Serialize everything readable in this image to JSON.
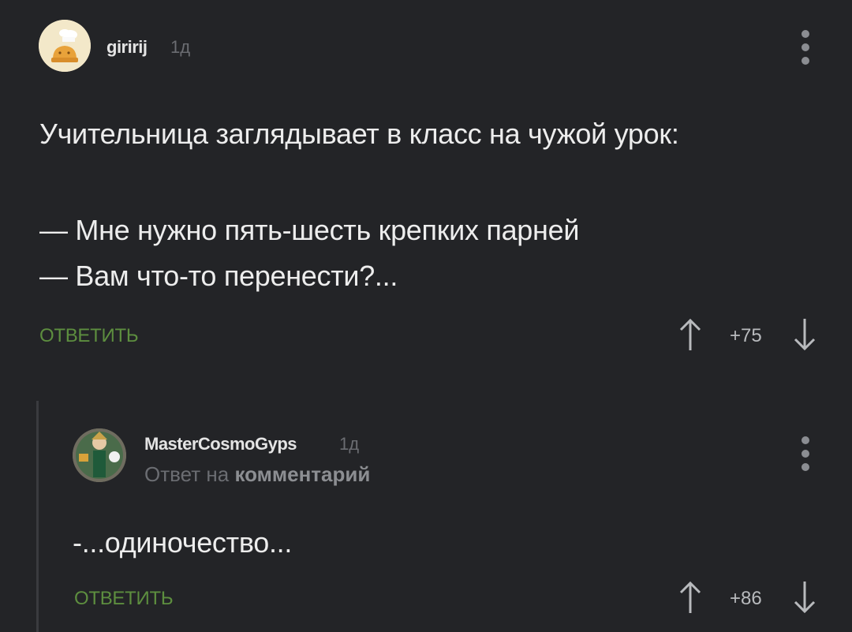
{
  "comment1": {
    "username": "giririj",
    "time": "1д",
    "text_line1": "Учительница заглядывает в класс на чужой урок:",
    "text_line2": "— Мне нужно пять-шесть крепких парней",
    "text_line3": "— Вам что-то перенести?...",
    "reply_label": "ОТВЕТИТЬ",
    "score": "+75",
    "avatar_icon": "chef-avatar-icon",
    "menu_icon": "more-vertical-icon"
  },
  "comment2": {
    "username": "MasterCosmoGyps",
    "time": "1д",
    "reply_prefix": "Ответ на",
    "reply_target": "комментарий",
    "text": "-...одиночество...",
    "reply_label": "ОТВЕТИТЬ",
    "score": "+86",
    "avatar_icon": "character-avatar-icon",
    "menu_icon": "more-vertical-icon"
  },
  "icons": {
    "upvote": "arrow-up-icon",
    "downvote": "arrow-down-icon"
  },
  "colors": {
    "background": "#232427",
    "reply_green": "#5d8e3f",
    "muted": "#6b6d72"
  }
}
